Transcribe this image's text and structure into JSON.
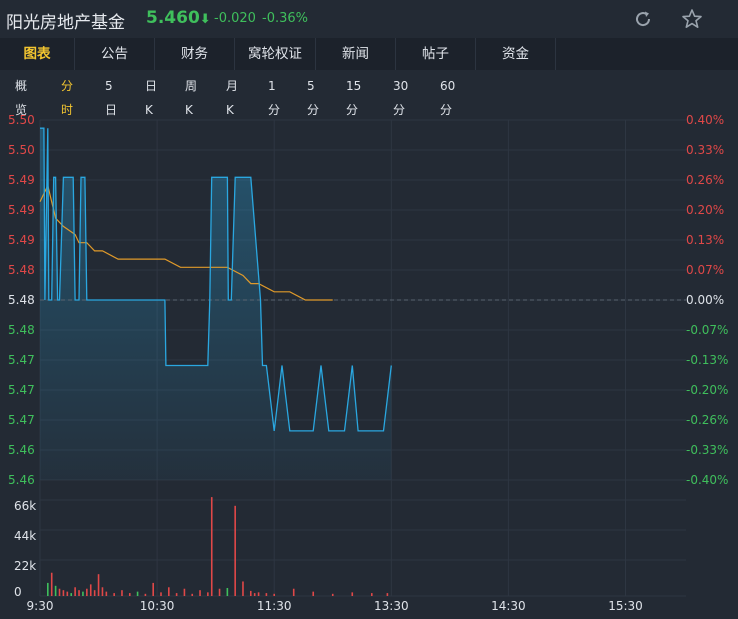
{
  "header": {
    "name": "阳光房地产基金",
    "price": "5.460",
    "change": "-0.020",
    "change_pct": "-0.36%",
    "icons": [
      "refresh-icon",
      "star-icon"
    ]
  },
  "tabs": [
    "图表",
    "公告",
    "财务",
    "窝轮权证",
    "新闻",
    "帖子",
    "资金"
  ],
  "active_tab": "图表",
  "subtabs": [
    "概览",
    "分时",
    "5日",
    "日K",
    "周K",
    "月K",
    "1分",
    "5分",
    "15分",
    "30分",
    "60分"
  ],
  "active_subtab": "分时",
  "colors": {
    "background": "#232a34",
    "up": "#e04848",
    "down": "#3fbf5c",
    "price_line": "#2aa7e0",
    "avg_line": "#e09a2a",
    "highlight": "#f2c530"
  },
  "chart_data": {
    "type": "line",
    "y_left_labels": [
      "5.50",
      "5.50",
      "5.49",
      "5.49",
      "5.49",
      "5.48",
      "5.48",
      "5.48",
      "5.47",
      "5.47",
      "5.47",
      "5.46",
      "5.46"
    ],
    "y_right_labels": [
      "0.40%",
      "0.33%",
      "0.26%",
      "0.20%",
      "0.13%",
      "0.07%",
      "0.00%",
      "-0.07%",
      "-0.13%",
      "-0.20%",
      "-0.26%",
      "-0.33%",
      "-0.40%"
    ],
    "prev_close": 5.48,
    "ylim": [
      5.458,
      5.502
    ],
    "x_labels": [
      "9:30",
      "10:30",
      "11:30",
      "13:30",
      "14:30",
      "15:30"
    ],
    "volume_labels": [
      "66k",
      "44k",
      "22k",
      "0"
    ],
    "volume_max": 66000,
    "price": {
      "name": "price",
      "x": [
        0,
        2,
        2.5,
        4,
        4.5,
        6,
        7,
        8,
        9,
        10,
        12,
        17,
        18,
        20,
        21,
        23,
        24,
        29,
        30,
        34,
        38,
        42,
        46,
        48,
        52,
        56,
        64,
        64.5,
        68,
        72,
        86,
        87,
        88,
        96,
        96.5,
        98,
        100,
        104,
        108,
        113,
        114,
        116,
        120,
        124,
        128,
        132,
        136,
        140,
        144,
        148,
        152,
        156,
        160,
        163,
        164,
        166,
        172,
        176,
        180
      ],
      "y": [
        5.501,
        5.501,
        5.48,
        5.501,
        5.48,
        5.48,
        5.495,
        5.495,
        5.48,
        5.48,
        5.495,
        5.495,
        5.48,
        5.48,
        5.495,
        5.495,
        5.48,
        5.48,
        5.48,
        5.48,
        5.48,
        5.48,
        5.48,
        5.48,
        5.48,
        5.48,
        5.48,
        5.472,
        5.472,
        5.472,
        5.472,
        5.48,
        5.495,
        5.495,
        5.48,
        5.48,
        5.495,
        5.495,
        5.495,
        5.48,
        5.472,
        5.472,
        5.464,
        5.472,
        5.464,
        5.464,
        5.464,
        5.464,
        5.472,
        5.464,
        5.464,
        5.464,
        5.472,
        5.464,
        5.464,
        5.464,
        5.464,
        5.464,
        5.472
      ]
    },
    "average": {
      "name": "avg",
      "x": [
        0,
        2,
        4,
        8,
        12,
        18,
        20,
        24,
        28,
        32,
        40,
        48,
        56,
        64,
        72,
        80,
        88,
        96,
        104,
        108,
        112,
        120,
        128,
        136,
        140,
        150
      ],
      "y": [
        5.492,
        5.493,
        5.494,
        5.49,
        5.489,
        5.488,
        5.487,
        5.487,
        5.486,
        5.486,
        5.485,
        5.485,
        5.485,
        5.485,
        5.484,
        5.484,
        5.484,
        5.484,
        5.483,
        5.482,
        5.482,
        5.481,
        5.481,
        5.48,
        5.48,
        5.48
      ]
    },
    "volume": {
      "x": [
        4,
        6,
        8,
        10,
        12,
        14,
        16,
        18,
        20,
        22,
        24,
        26,
        28,
        30,
        32,
        34,
        38,
        42,
        46,
        50,
        54,
        58,
        62,
        66,
        70,
        74,
        78,
        82,
        86,
        88,
        92,
        96,
        100,
        104,
        108,
        110,
        112,
        116,
        120,
        130,
        140,
        150,
        160,
        170,
        178
      ],
      "v": [
        9000,
        16000,
        7000,
        5000,
        4000,
        3000,
        2000,
        6000,
        4000,
        3000,
        5000,
        8000,
        4000,
        15000,
        6000,
        3000,
        2000,
        4000,
        2000,
        3000,
        1500,
        9000,
        2500,
        6000,
        2000,
        5000,
        1500,
        4000,
        2500,
        68000,
        5000,
        5500,
        62000,
        10000,
        3500,
        2000,
        2500,
        2000,
        1500,
        5000,
        3000,
        1500,
        2500,
        2000,
        2000
      ],
      "up": [
        false,
        true,
        false,
        true,
        true,
        true,
        false,
        true,
        true,
        false,
        true,
        true,
        true,
        true,
        true,
        true,
        true,
        true,
        true,
        false,
        true,
        true,
        true,
        true,
        true,
        true,
        true,
        true,
        true,
        true,
        true,
        false,
        true,
        true,
        true,
        true,
        true,
        true,
        true,
        true,
        true,
        true,
        true,
        true,
        true
      ]
    },
    "grid": true
  }
}
